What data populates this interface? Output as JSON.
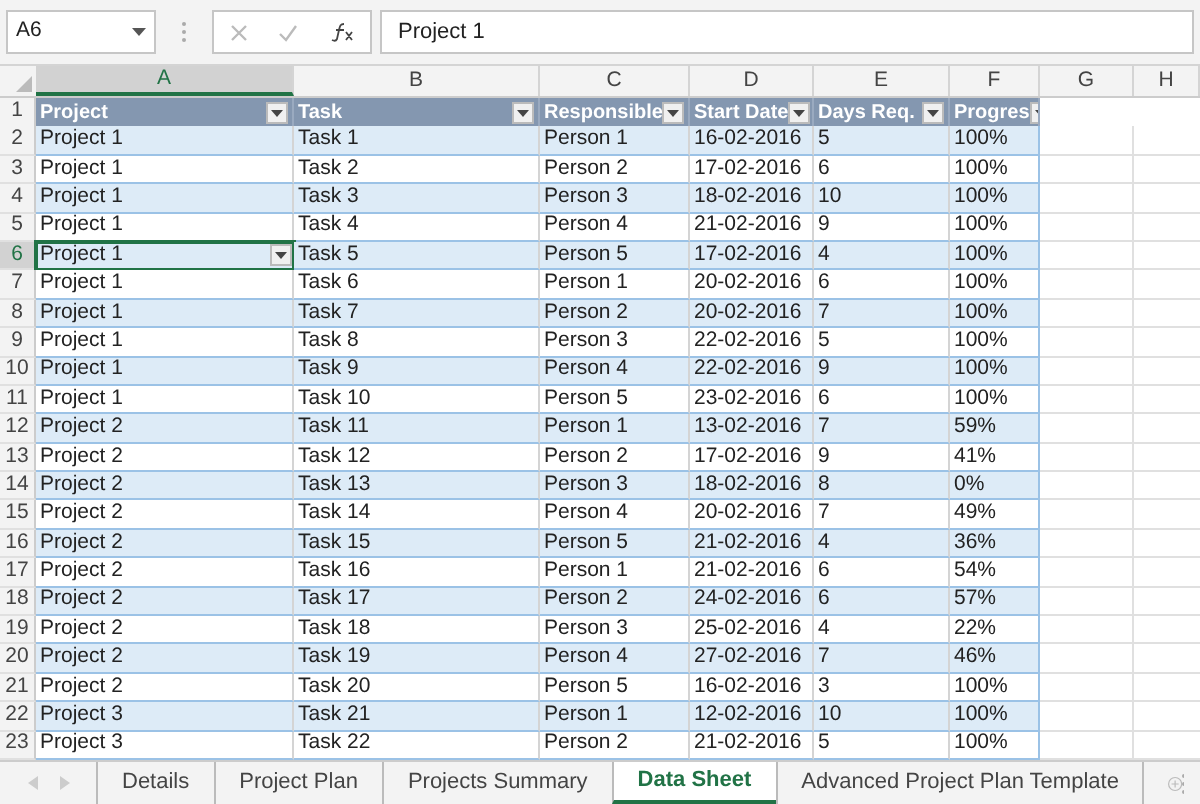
{
  "name_box": "A6",
  "formula": "Project 1",
  "columns": [
    {
      "label": "A",
      "selected": true
    },
    {
      "label": "B",
      "selected": false
    },
    {
      "label": "C",
      "selected": false
    },
    {
      "label": "D",
      "selected": false
    },
    {
      "label": "E",
      "selected": false
    },
    {
      "label": "F",
      "selected": false
    },
    {
      "label": "G",
      "selected": false
    },
    {
      "label": "H",
      "selected": false
    }
  ],
  "header_row": {
    "number": "1",
    "cells": [
      "Project",
      "Task",
      "Responsible",
      "Start Date",
      "Days Req.",
      "Progres"
    ]
  },
  "rows": [
    {
      "number": "2",
      "selected": false,
      "cells": [
        "Project 1",
        "Task 1",
        "Person 1",
        "16-02-2016",
        "5",
        "100%"
      ]
    },
    {
      "number": "3",
      "selected": false,
      "cells": [
        "Project 1",
        "Task 2",
        "Person 2",
        "17-02-2016",
        "6",
        "100%"
      ]
    },
    {
      "number": "4",
      "selected": false,
      "cells": [
        "Project 1",
        "Task 3",
        "Person 3",
        "18-02-2016",
        "10",
        "100%"
      ]
    },
    {
      "number": "5",
      "selected": false,
      "cells": [
        "Project 1",
        "Task 4",
        "Person 4",
        "21-02-2016",
        "9",
        "100%"
      ]
    },
    {
      "number": "6",
      "selected": true,
      "cells": [
        "Project 1",
        "Task 5",
        "Person 5",
        "17-02-2016",
        "4",
        "100%"
      ]
    },
    {
      "number": "7",
      "selected": false,
      "cells": [
        "Project 1",
        "Task 6",
        "Person 1",
        "20-02-2016",
        "6",
        "100%"
      ]
    },
    {
      "number": "8",
      "selected": false,
      "cells": [
        "Project 1",
        "Task 7",
        "Person 2",
        "20-02-2016",
        "7",
        "100%"
      ]
    },
    {
      "number": "9",
      "selected": false,
      "cells": [
        "Project 1",
        "Task 8",
        "Person 3",
        "22-02-2016",
        "5",
        "100%"
      ]
    },
    {
      "number": "10",
      "selected": false,
      "cells": [
        "Project 1",
        "Task 9",
        "Person 4",
        "22-02-2016",
        "9",
        "100%"
      ]
    },
    {
      "number": "11",
      "selected": false,
      "cells": [
        "Project 1",
        "Task 10",
        "Person 5",
        "23-02-2016",
        "6",
        "100%"
      ]
    },
    {
      "number": "12",
      "selected": false,
      "cells": [
        "Project 2",
        "Task 11",
        "Person 1",
        "13-02-2016",
        "7",
        "59%"
      ]
    },
    {
      "number": "13",
      "selected": false,
      "cells": [
        "Project 2",
        "Task 12",
        "Person 2",
        "17-02-2016",
        "9",
        "41%"
      ]
    },
    {
      "number": "14",
      "selected": false,
      "cells": [
        "Project 2",
        "Task 13",
        "Person 3",
        "18-02-2016",
        "8",
        "0%"
      ]
    },
    {
      "number": "15",
      "selected": false,
      "cells": [
        "Project 2",
        "Task 14",
        "Person 4",
        "20-02-2016",
        "7",
        "49%"
      ]
    },
    {
      "number": "16",
      "selected": false,
      "cells": [
        "Project 2",
        "Task 15",
        "Person 5",
        "21-02-2016",
        "4",
        "36%"
      ]
    },
    {
      "number": "17",
      "selected": false,
      "cells": [
        "Project 2",
        "Task 16",
        "Person 1",
        "21-02-2016",
        "6",
        "54%"
      ]
    },
    {
      "number": "18",
      "selected": false,
      "cells": [
        "Project 2",
        "Task 17",
        "Person 2",
        "24-02-2016",
        "6",
        "57%"
      ]
    },
    {
      "number": "19",
      "selected": false,
      "cells": [
        "Project 2",
        "Task 18",
        "Person 3",
        "25-02-2016",
        "4",
        "22%"
      ]
    },
    {
      "number": "20",
      "selected": false,
      "cells": [
        "Project 2",
        "Task 19",
        "Person 4",
        "27-02-2016",
        "7",
        "46%"
      ]
    },
    {
      "number": "21",
      "selected": false,
      "cells": [
        "Project 2",
        "Task 20",
        "Person 5",
        "16-02-2016",
        "3",
        "100%"
      ]
    },
    {
      "number": "22",
      "selected": false,
      "cells": [
        "Project 3",
        "Task 21",
        "Person 1",
        "12-02-2016",
        "10",
        "100%"
      ]
    },
    {
      "number": "23",
      "selected": false,
      "cells": [
        "Project 3",
        "Task 22",
        "Person 2",
        "21-02-2016",
        "5",
        "100%"
      ]
    }
  ],
  "sheet_tabs": [
    {
      "label": "Details",
      "selected": false
    },
    {
      "label": "Project Plan",
      "selected": false
    },
    {
      "label": "Projects Summary",
      "selected": false
    },
    {
      "label": "Data Sheet",
      "selected": true
    },
    {
      "label": "Advanced Project Plan Template",
      "selected": false
    }
  ]
}
